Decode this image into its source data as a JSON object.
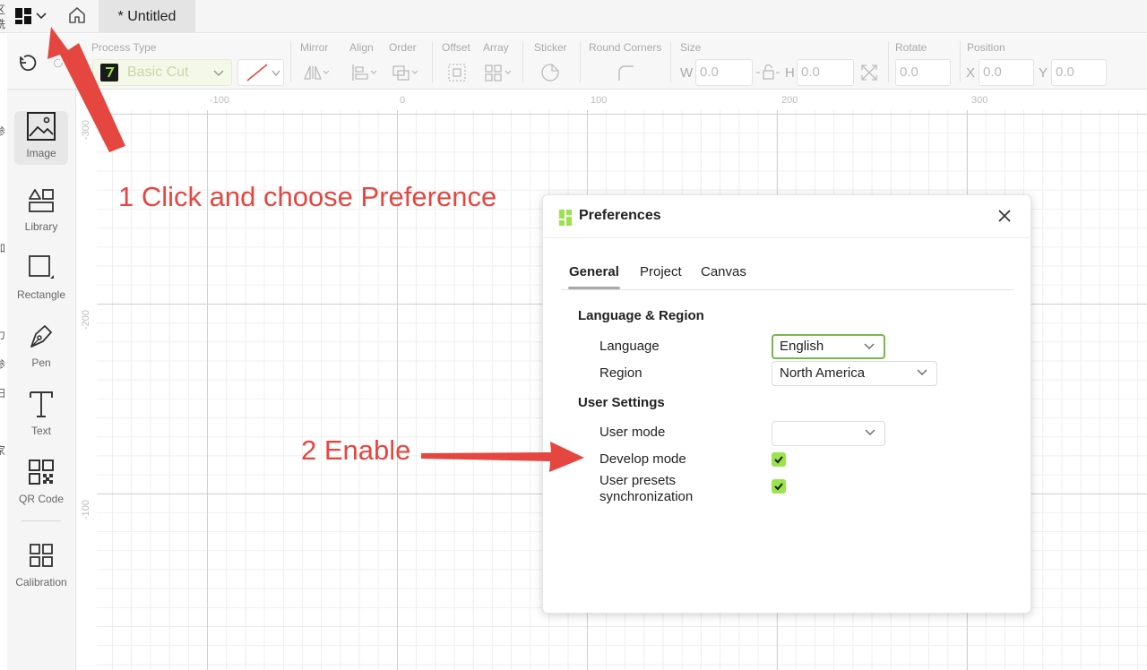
{
  "window": {
    "document_tab": "* Untitled"
  },
  "edge_glyphs": [
    "区",
    "铣",
    "参",
    "加",
    "力",
    "参",
    "扫",
    "家"
  ],
  "toolbar": {
    "process_type_label": "Process Type",
    "process_type_value": "Basic Cut",
    "mirror_label": "Mirror",
    "align_label": "Align",
    "order_label": "Order",
    "offset_label": "Offset",
    "array_label": "Array",
    "sticker_label": "Sticker",
    "round_corners_label": "Round Corners",
    "size_label": "Size",
    "w_label": "W",
    "w_value": "0.0",
    "h_label": "H",
    "h_value": "0.0",
    "rotate_label": "Rotate",
    "rotate_value": "0.0",
    "position_label": "Position",
    "x_label": "X",
    "x_value": "0.0",
    "y_label": "Y",
    "y_value": "0.0"
  },
  "sidebar": {
    "items": [
      {
        "label": "Image",
        "icon": "image-icon"
      },
      {
        "label": "Library",
        "icon": "library-icon"
      },
      {
        "label": "Rectangle",
        "icon": "rectangle-icon"
      },
      {
        "label": "Pen",
        "icon": "pen-icon"
      },
      {
        "label": "Text",
        "icon": "text-icon"
      },
      {
        "label": "QR Code",
        "icon": "qr-code-icon"
      },
      {
        "label": "Calibration",
        "icon": "calibration-icon"
      }
    ]
  },
  "rulers": {
    "top": [
      "-100",
      "0",
      "100",
      "200",
      "300"
    ],
    "left": [
      "-300",
      "-200",
      "-100"
    ]
  },
  "annotations": {
    "step1": "1 Click and choose Preference",
    "step2": "2 Enable",
    "color": "#e5463f"
  },
  "preferences": {
    "title": "Preferences",
    "tabs": [
      "General",
      "Project",
      "Canvas"
    ],
    "active_tab": "General",
    "language_region_heading": "Language & Region",
    "language_label": "Language",
    "language_value": "English",
    "region_label": "Region",
    "region_value": "North America",
    "user_settings_heading": "User Settings",
    "user_mode_label": "User mode",
    "user_mode_value": "",
    "develop_mode_label": "Develop mode",
    "develop_mode_checked": true,
    "user_presets_label_line1": "User presets",
    "user_presets_label_line2": "synchronization",
    "user_presets_checked": true,
    "accent_color": "#9be34a"
  }
}
